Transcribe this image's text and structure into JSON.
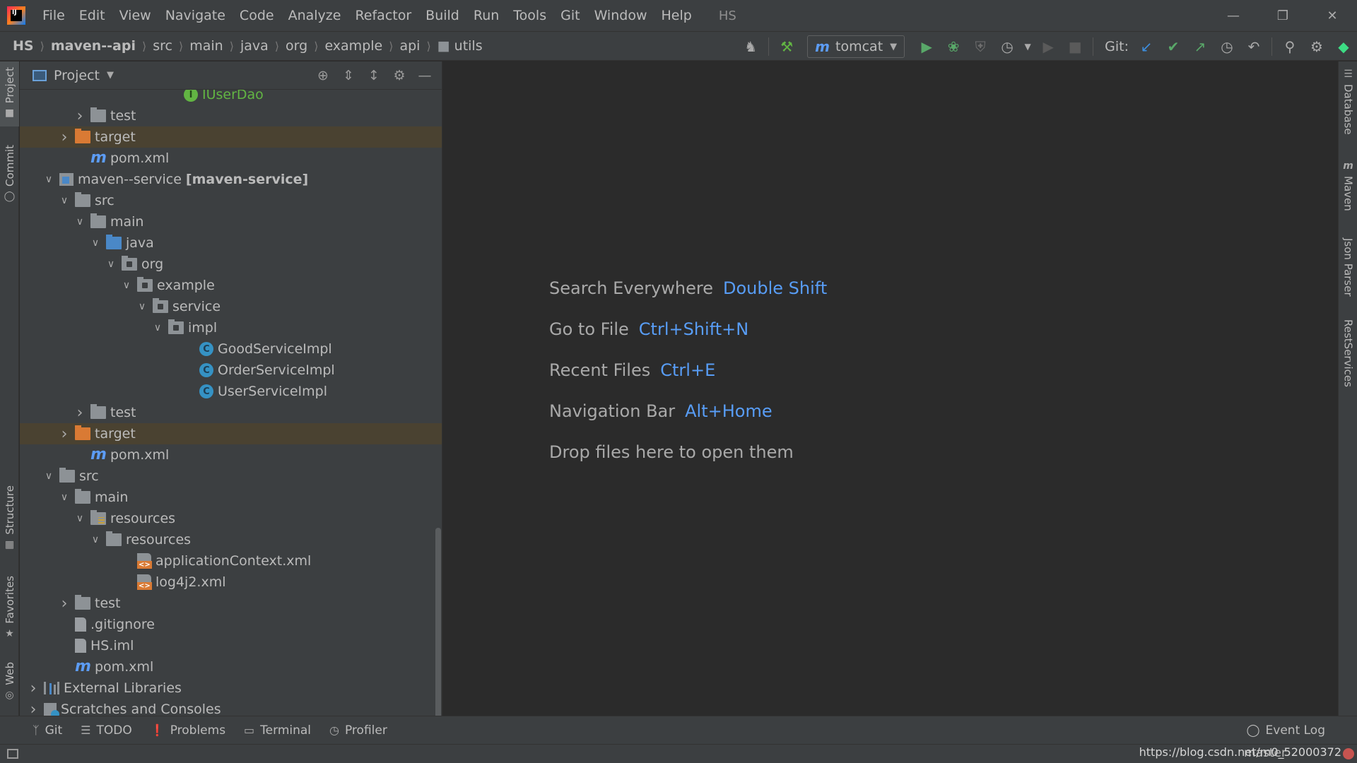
{
  "app": {
    "window_title": "HS",
    "menu": [
      "File",
      "Edit",
      "View",
      "Navigate",
      "Code",
      "Analyze",
      "Refactor",
      "Build",
      "Run",
      "Tools",
      "Git",
      "Window",
      "Help"
    ]
  },
  "breadcrumb": [
    "HS",
    "maven--api",
    "src",
    "main",
    "java",
    "org",
    "example",
    "api",
    "utils"
  ],
  "toolbar": {
    "run_config": "tomcat",
    "git_label": "Git:"
  },
  "project_panel": {
    "title": "Project",
    "tree": [
      {
        "label": "IUserDao",
        "type": "interface",
        "indent": 9,
        "arrow": "",
        "partial": true
      },
      {
        "label": "test",
        "type": "folder",
        "indent": 3,
        "arrow": "collapsed"
      },
      {
        "label": "target",
        "type": "folder-orange",
        "indent": 2,
        "arrow": "collapsed",
        "excluded": true
      },
      {
        "label": "pom.xml",
        "type": "maven",
        "indent": 3,
        "arrow": ""
      },
      {
        "label": "maven--service",
        "suffix": "[maven-service]",
        "type": "module",
        "indent": 1,
        "arrow": "expanded"
      },
      {
        "label": "src",
        "type": "folder",
        "indent": 2,
        "arrow": "expanded"
      },
      {
        "label": "main",
        "type": "folder",
        "indent": 3,
        "arrow": "expanded"
      },
      {
        "label": "java",
        "type": "folder-src",
        "indent": 4,
        "arrow": "expanded"
      },
      {
        "label": "org",
        "type": "package",
        "indent": 5,
        "arrow": "expanded"
      },
      {
        "label": "example",
        "type": "package",
        "indent": 6,
        "arrow": "expanded"
      },
      {
        "label": "service",
        "type": "package",
        "indent": 7,
        "arrow": "expanded"
      },
      {
        "label": "impl",
        "type": "package",
        "indent": 8,
        "arrow": "expanded"
      },
      {
        "label": "GoodServiceImpl",
        "type": "class",
        "indent": 10,
        "arrow": ""
      },
      {
        "label": "OrderServiceImpl",
        "type": "class",
        "indent": 10,
        "arrow": ""
      },
      {
        "label": "UserServiceImpl",
        "type": "class",
        "indent": 10,
        "arrow": ""
      },
      {
        "label": "test",
        "type": "folder",
        "indent": 3,
        "arrow": "collapsed"
      },
      {
        "label": "target",
        "type": "folder-orange",
        "indent": 2,
        "arrow": "collapsed",
        "excluded": true
      },
      {
        "label": "pom.xml",
        "type": "maven",
        "indent": 3,
        "arrow": ""
      },
      {
        "label": "src",
        "type": "folder",
        "indent": 1,
        "arrow": "expanded"
      },
      {
        "label": "main",
        "type": "folder",
        "indent": 2,
        "arrow": "expanded"
      },
      {
        "label": "resources",
        "type": "folder-res",
        "indent": 3,
        "arrow": "expanded"
      },
      {
        "label": "resources",
        "type": "folder",
        "indent": 4,
        "arrow": "expanded"
      },
      {
        "label": "applicationContext.xml",
        "type": "xml",
        "indent": 6,
        "arrow": ""
      },
      {
        "label": "log4j2.xml",
        "type": "xml",
        "indent": 6,
        "arrow": ""
      },
      {
        "label": "test",
        "type": "folder",
        "indent": 2,
        "arrow": "collapsed"
      },
      {
        "label": ".gitignore",
        "type": "file",
        "indent": 2,
        "arrow": ""
      },
      {
        "label": "HS.iml",
        "type": "file",
        "indent": 2,
        "arrow": ""
      },
      {
        "label": "pom.xml",
        "type": "maven",
        "indent": 2,
        "arrow": ""
      },
      {
        "label": "External Libraries",
        "type": "libs",
        "indent": 0,
        "arrow": "collapsed"
      },
      {
        "label": "Scratches and Consoles",
        "type": "scratch",
        "indent": 0,
        "arrow": "collapsed"
      }
    ]
  },
  "left_tabs": [
    "Project",
    "Commit",
    "Structure",
    "Favorites",
    "Web"
  ],
  "right_tabs": [
    "Database",
    "Maven",
    "Json Parser",
    "RestServices"
  ],
  "editor_hints": [
    {
      "text": "Search Everywhere",
      "key": "Double Shift"
    },
    {
      "text": "Go to File",
      "key": "Ctrl+Shift+N"
    },
    {
      "text": "Recent Files",
      "key": "Ctrl+E"
    },
    {
      "text": "Navigation Bar",
      "key": "Alt+Home"
    },
    {
      "text": "Drop files here to open them",
      "key": ""
    }
  ],
  "bottom_tabs": [
    "Git",
    "TODO",
    "Problems",
    "Terminal",
    "Profiler"
  ],
  "event_log": "Event Log",
  "status": {
    "branch": "master",
    "watermark": "https://blog.csdn.net/m0_52000372"
  }
}
